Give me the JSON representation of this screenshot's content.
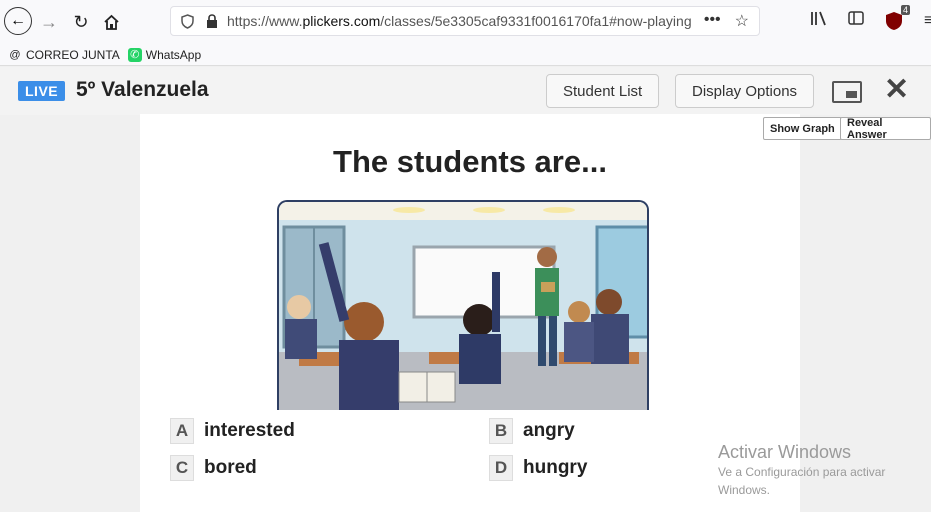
{
  "browser": {
    "url_prefix": "https://www.",
    "url_host": "plickers.com",
    "url_path": "/classes/5e3305caf9331f0016170fa1#now-playing",
    "ublock_count": "4"
  },
  "bookmarks": [
    {
      "label": "CORREO JUNTA",
      "icon": "at-icon"
    },
    {
      "label": "WhatsApp",
      "icon": "whatsapp-icon"
    }
  ],
  "header": {
    "live_label": "LIVE",
    "class_name": "5º Valenzuela",
    "student_list_label": "Student List",
    "display_options_label": "Display Options"
  },
  "slide": {
    "question": "The students are...",
    "show_graph_label": "Show Graph",
    "reveal_answer_label": "Reveal Answer",
    "choices": [
      {
        "letter": "A",
        "text": "interested"
      },
      {
        "letter": "B",
        "text": "angry"
      },
      {
        "letter": "C",
        "text": "bored"
      },
      {
        "letter": "D",
        "text": "hungry"
      }
    ]
  },
  "watermark": {
    "title": "Activar Windows",
    "subtitle": "Ve a Configuración para activar Windows."
  },
  "colors": {
    "live_badge": "#3b8ee8",
    "frame_border": "#2e3f63"
  }
}
